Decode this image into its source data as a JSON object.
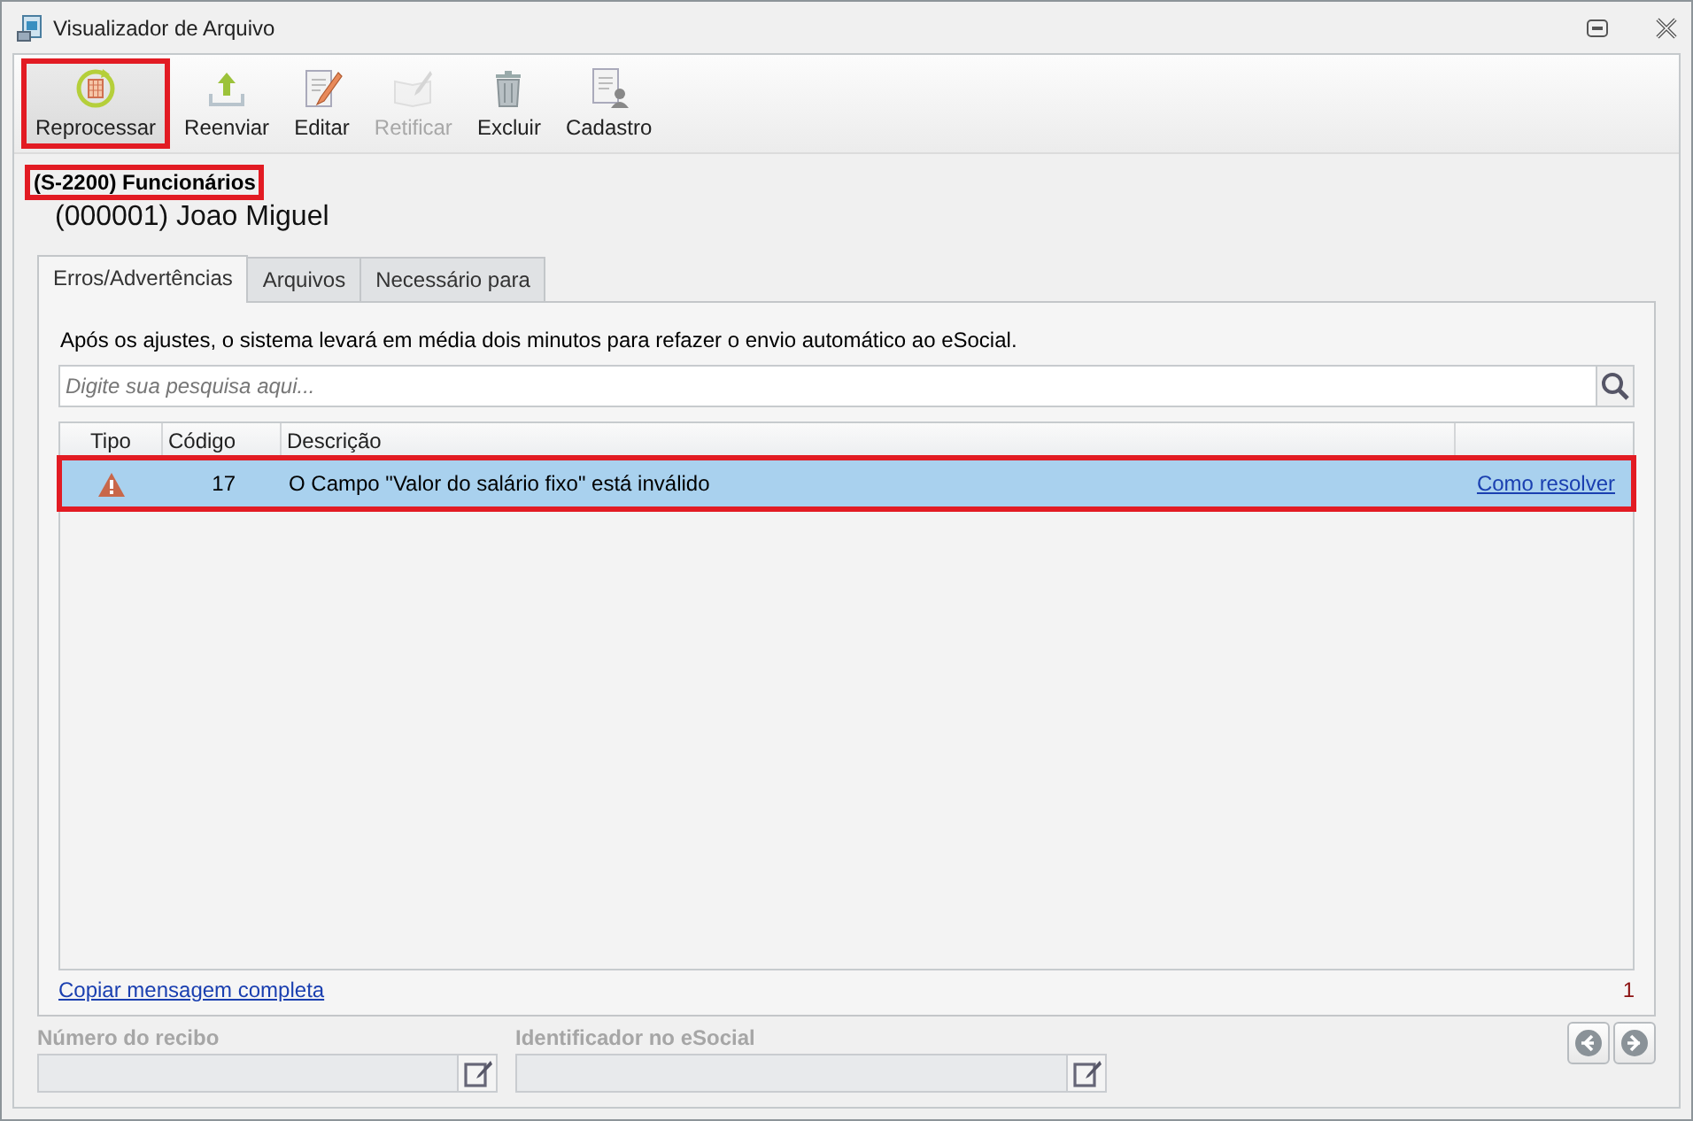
{
  "window": {
    "title": "Visualizador de Arquivo"
  },
  "toolbar": [
    {
      "label": "Reprocessar",
      "disabled": false,
      "highlighted": true
    },
    {
      "label": "Reenviar",
      "disabled": false,
      "highlighted": false
    },
    {
      "label": "Editar",
      "disabled": false,
      "highlighted": false
    },
    {
      "label": "Retificar",
      "disabled": true,
      "highlighted": false
    },
    {
      "label": "Excluir",
      "disabled": false,
      "highlighted": false
    },
    {
      "label": "Cadastro",
      "disabled": false,
      "highlighted": false
    }
  ],
  "event": {
    "title": "(S-2200) Funcionários",
    "highlighted": true
  },
  "subject": "(000001) Joao Miguel",
  "tabs": [
    {
      "label": "Erros/Advertências",
      "selected": true
    },
    {
      "label": "Arquivos",
      "selected": false
    },
    {
      "label": "Necessário para",
      "selected": false
    }
  ],
  "message": "Após os ajustes, o sistema levará em média dois minutos para refazer o envio automático ao eSocial.",
  "search": {
    "placeholder": "Digite sua pesquisa aqui..."
  },
  "table": {
    "columns": [
      "Tipo",
      "Código",
      "Descrição"
    ],
    "rows": [
      {
        "kind": "warning",
        "code": "17",
        "description": "O Campo \"Valor do salário fixo\" está inválido",
        "link": "Como resolver",
        "selected": true,
        "highlighted": true
      }
    ]
  },
  "copy_link": "Copiar mensagem completa",
  "count": "1",
  "fields": [
    {
      "label": "Número do recibo",
      "disabled": true
    },
    {
      "label": "Identificador no eSocial",
      "disabled": true
    }
  ]
}
